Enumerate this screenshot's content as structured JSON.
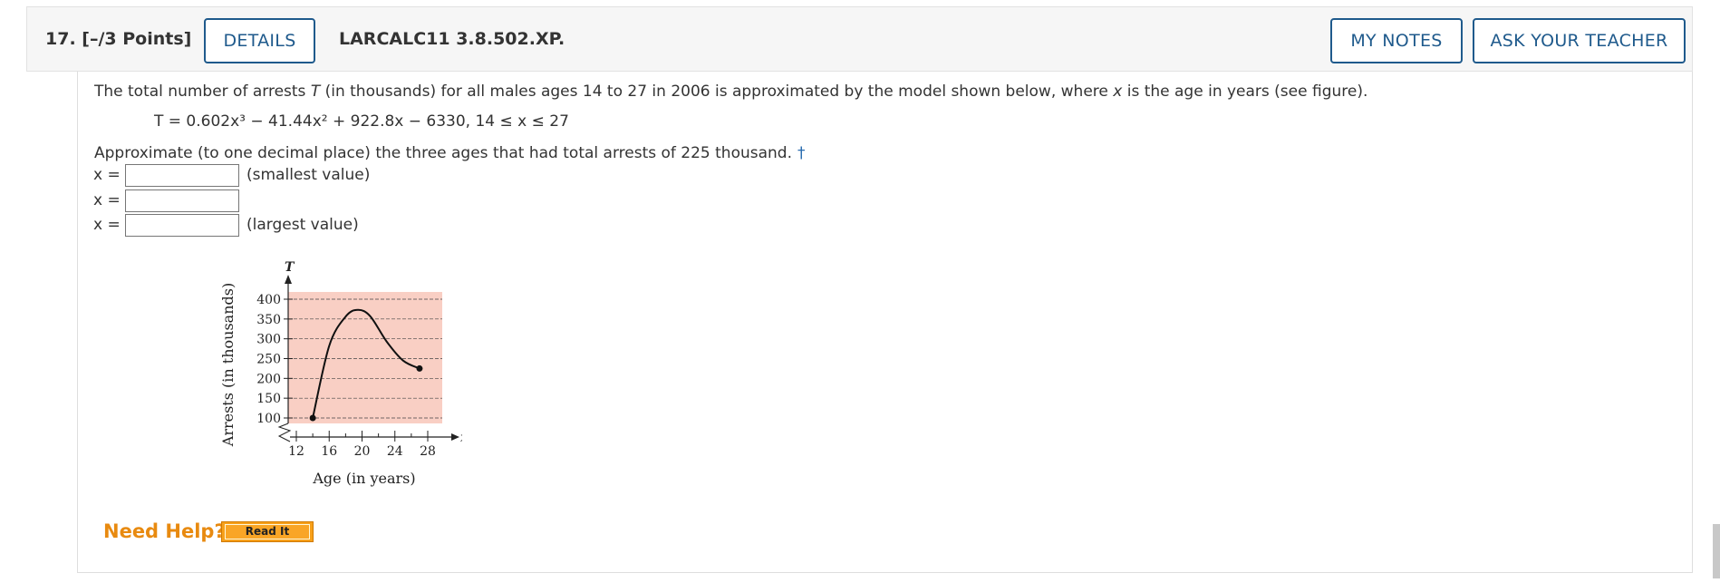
{
  "header": {
    "question_number": "17.",
    "points": "[–/3 Points]",
    "details_label": "DETAILS",
    "problem_code": "LARCALC11 3.8.502.XP.",
    "my_notes_label": "MY NOTES",
    "ask_teacher_label": "ASK YOUR TEACHER"
  },
  "problem": {
    "intro_start": "The total number of arrests ",
    "intro_var": "T",
    "intro_mid": " (in thousands) for all males ages 14 to 27 in 2006 is approximated by the model shown below, where ",
    "intro_var2": "x",
    "intro_end": " is the age in years (see figure).",
    "model": "T = 0.602x³ − 41.44x² + 922.8x − 6330,   14 ≤ x ≤ 27",
    "instruction": "Approximate (to one decimal place) the three ages that had total arrests of 225 thousand.",
    "dagger": "†"
  },
  "answers": [
    {
      "label": "x =",
      "value": "",
      "note": "(smallest value)"
    },
    {
      "label": "x =",
      "value": "",
      "note": ""
    },
    {
      "label": "x =",
      "value": "",
      "note": "(largest value)"
    }
  ],
  "chart_data": {
    "type": "line",
    "x": [
      14,
      16,
      18,
      19.5,
      21,
      23,
      25,
      27
    ],
    "y": [
      100,
      282,
      356,
      373,
      357,
      293,
      245,
      225
    ],
    "xlabel": "Age (in years)",
    "ylabel": "Arrests (in thousands)",
    "yvar": "T",
    "xvar": "x",
    "xticks": [
      "12",
      "16",
      "20",
      "24",
      "28"
    ],
    "yticks": [
      "100",
      "150",
      "200",
      "250",
      "300",
      "350",
      "400"
    ],
    "xlim": [
      12,
      28
    ],
    "ylim": [
      100,
      400
    ],
    "background": "#f9cfc4",
    "grid": true
  },
  "help": {
    "need_help": "Need Help?",
    "read_it": "Read It"
  }
}
